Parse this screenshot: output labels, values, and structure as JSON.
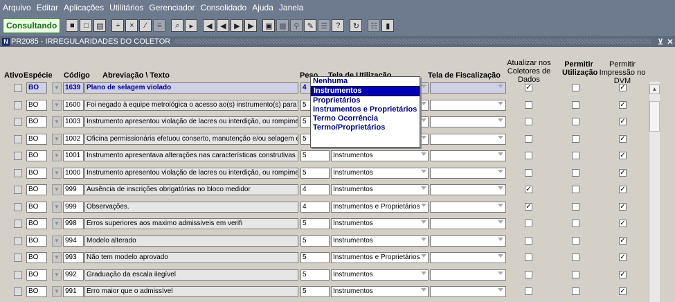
{
  "menu": [
    "Arquivo",
    "Editar",
    "Aplicações",
    "Utilitários",
    "Gerenciador",
    "Consolidado",
    "Ajuda",
    "Janela"
  ],
  "toolbar": {
    "mode_label": "Consultando"
  },
  "window": {
    "title": "PR2085 - IRREGULARIDADES DO COLETOR",
    "close_glyph": "✕",
    "min_glyph": "⊻"
  },
  "headers": {
    "ativo": "Ativo",
    "especie": "Espécie",
    "codigo": "Código",
    "abreviacao": "Abreviação \\ Texto",
    "peso": "Peso",
    "tela_utilizacao": "Tela de Utilização",
    "tela_fiscalizacao": "Tela de Fiscalização",
    "atualizar": "Atualizar nos Coletores de Dados",
    "permitir_utilizacao": "Permitir Utilização",
    "permitir_impressao": "Permitir Impressão no DVM"
  },
  "rows": [
    {
      "especie": "BO",
      "codigo": "1639",
      "texto": "Plano de selagem violado",
      "peso": "4",
      "tela": "",
      "atualizar": true,
      "utilizacao": false,
      "impressao": true
    },
    {
      "especie": "BO",
      "codigo": "1600",
      "texto": "Foi negado à equipe metrológica o acesso ao(s) instrumento(s) para a realização",
      "peso": "5",
      "tela": "",
      "atualizar": false,
      "utilizacao": false,
      "impressao": true
    },
    {
      "especie": "BO",
      "codigo": "1003",
      "texto": "Instrumento apresentou violação de lacres ou interdição, ou rompimento do selo",
      "peso": "5",
      "tela": "",
      "atualizar": false,
      "utilizacao": false,
      "impressao": true
    },
    {
      "especie": "BO",
      "codigo": "1002",
      "texto": "Oficina permissionária efetuou conserto, manutenção e/ou selagem em bomba",
      "peso": "5",
      "tela": "",
      "atualizar": false,
      "utilizacao": false,
      "impressao": true
    },
    {
      "especie": "BO",
      "codigo": "1001",
      "texto": "Instrumento apresentava alterações nas características construtivas em relação",
      "peso": "5",
      "tela": "Instrumentos",
      "atualizar": false,
      "utilizacao": false,
      "impressao": true
    },
    {
      "especie": "BO",
      "codigo": "1000",
      "texto": "Instrumento apresentou violação de lacres ou interdição, ou rompimento do selo",
      "peso": "5",
      "tela": "Instrumentos",
      "atualizar": false,
      "utilizacao": false,
      "impressao": true
    },
    {
      "especie": "BO",
      "codigo": "999",
      "texto": "Ausência de inscrições obrigatórias no bloco medidor",
      "peso": "4",
      "tela": "Instrumentos",
      "atualizar": true,
      "utilizacao": false,
      "impressao": true
    },
    {
      "especie": "BO",
      "codigo": "999",
      "texto": "Observações.",
      "peso": "4",
      "tela": "Instrumentos e Proprietários",
      "atualizar": true,
      "utilizacao": false,
      "impressao": true
    },
    {
      "especie": "BO",
      "codigo": "998",
      "texto": "Erros superiores aos maximo admissiveis em verifi",
      "peso": "5",
      "tela": "Instrumentos",
      "atualizar": false,
      "utilizacao": false,
      "impressao": true
    },
    {
      "especie": "BO",
      "codigo": "994",
      "texto": "Modelo alterado",
      "peso": "5",
      "tela": "Instrumentos",
      "atualizar": false,
      "utilizacao": false,
      "impressao": true
    },
    {
      "especie": "BO",
      "codigo": "993",
      "texto": "Não tem modelo aprovado",
      "peso": "5",
      "tela": "Instrumentos e Proprietários",
      "atualizar": false,
      "utilizacao": false,
      "impressao": true
    },
    {
      "especie": "BO",
      "codigo": "992",
      "texto": "Graduação da escala ilegível",
      "peso": "5",
      "tela": "Instrumentos",
      "atualizar": false,
      "utilizacao": false,
      "impressao": true
    },
    {
      "especie": "BO",
      "codigo": "991",
      "texto": "Erro maior que o admissível",
      "peso": "5",
      "tela": "Instrumentos",
      "atualizar": false,
      "utilizacao": false,
      "impressao": true
    }
  ],
  "popup": {
    "options": [
      "Nenhuma",
      "Instrumentos",
      "Proprietários",
      "Instrumentos e Proprietários",
      "Termo Ocorrência",
      "Termo/Proprietários"
    ],
    "selected_index": 1
  }
}
